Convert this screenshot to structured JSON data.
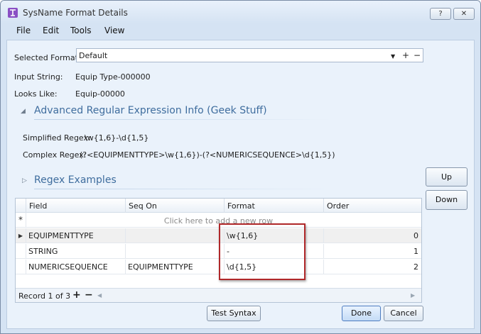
{
  "window": {
    "title": "SysName Format Details",
    "help_label": "?",
    "close_label": "✕"
  },
  "menu": [
    "File",
    "Edit",
    "Tools",
    "View"
  ],
  "form": {
    "selected_format_label": "Selected Format:",
    "selected_format_value": "Default",
    "input_string_label": "Input String:",
    "input_string_value": "Equip Type-000000",
    "looks_like_label": "Looks Like:",
    "looks_like_value": "Equip-00000"
  },
  "advanced": {
    "title": "Advanced Regular Expression Info (Geek Stuff)",
    "simplified_label": "Simplified Regex:",
    "simplified_value": "\\w{1,6}-\\d{1,5}",
    "complex_label": "Complex Regex:",
    "complex_value": "(?<EQUIPMENTTYPE>\\w{1,6})-(?<NUMERICSEQUENCE>\\d{1,5})"
  },
  "examples": {
    "title": "Regex Examples"
  },
  "side_buttons": {
    "up": "Up",
    "down": "Down"
  },
  "grid": {
    "columns": [
      "Field",
      "Seq On",
      "Format",
      "Order"
    ],
    "new_row_text": "Click here to add a new row",
    "new_row_marker": "*",
    "rows": [
      {
        "field": "EQUIPMENTTYPE",
        "seq_on": "",
        "format": "\\w{1,6}",
        "order": "0"
      },
      {
        "field": "STRING",
        "seq_on": "",
        "format": "-",
        "order": "1"
      },
      {
        "field": "NUMERICSEQUENCE",
        "seq_on": "EQUIPMENTTYPE",
        "format": "\\d{1,5}",
        "order": "2"
      }
    ],
    "record_text": "Record 1 of 3"
  },
  "buttons": {
    "test_syntax": "Test Syntax",
    "done": "Done",
    "cancel": "Cancel"
  },
  "colors": {
    "accent": "#3f6d9e",
    "highlight_border": "#b0282a",
    "panel_bg": "#eaf2fb"
  }
}
